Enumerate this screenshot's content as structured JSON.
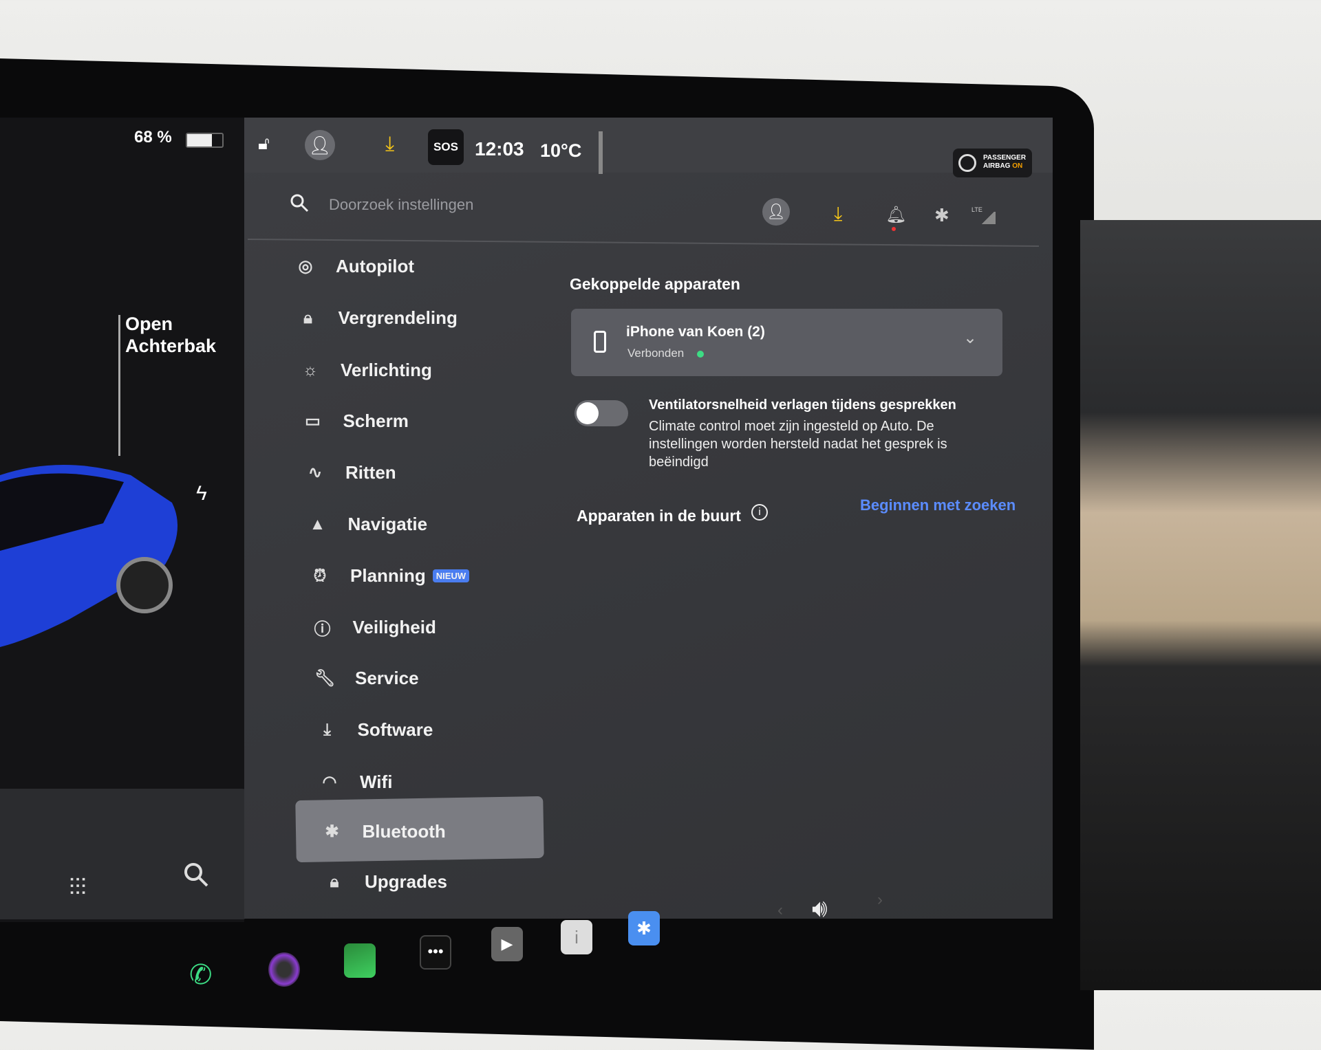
{
  "left_panel": {
    "battery": "68 %",
    "trunk_label_1": "Open",
    "trunk_label_2": "Achterbak",
    "car_color": "#1e3fd6"
  },
  "status_bar": {
    "time": "12:03",
    "temperature": "10°C",
    "sos": "SOS",
    "airbag_line1": "PASSENGER",
    "airbag_line2": "AIRBAG",
    "airbag_state": "ON",
    "lte": "LTE"
  },
  "search": {
    "placeholder": "Doorzoek instellingen"
  },
  "menu": {
    "items": [
      {
        "label": "Autopilot",
        "icon": "steering-wheel-icon"
      },
      {
        "label": "Vergrendeling",
        "icon": "lock-icon"
      },
      {
        "label": "Verlichting",
        "icon": "sun-icon"
      },
      {
        "label": "Scherm",
        "icon": "display-icon"
      },
      {
        "label": "Ritten",
        "icon": "trips-icon"
      },
      {
        "label": "Navigatie",
        "icon": "navigation-icon"
      },
      {
        "label": "Planning",
        "icon": "clock-icon",
        "badge": "NIEUW"
      },
      {
        "label": "Veiligheid",
        "icon": "alert-icon"
      },
      {
        "label": "Service",
        "icon": "wrench-icon"
      },
      {
        "label": "Software",
        "icon": "download-icon"
      },
      {
        "label": "Wifi",
        "icon": "wifi-icon"
      },
      {
        "label": "Bluetooth",
        "icon": "bluetooth-icon",
        "selected": true
      },
      {
        "label": "Upgrades",
        "icon": "bag-icon"
      }
    ]
  },
  "bluetooth": {
    "paired_title": "Gekoppelde apparaten",
    "device_name": "iPhone van Koen (2)",
    "device_status": "Verbonden",
    "status_color": "#3ddc84",
    "toggle_title": "Ventilatorsnelheid verlagen tijdens gesprekken",
    "toggle_desc": "Climate control moet zijn ingesteld op Auto. De instellingen worden hersteld nadat het gesprek is beëindigd",
    "toggle_on": false,
    "nearby_title": "Apparaten in de buurt",
    "start_search": "Beginnen met zoeken",
    "link_color": "#5b8cff"
  },
  "accent": {
    "download": "#f5c518",
    "badge": "#4a7df0"
  }
}
